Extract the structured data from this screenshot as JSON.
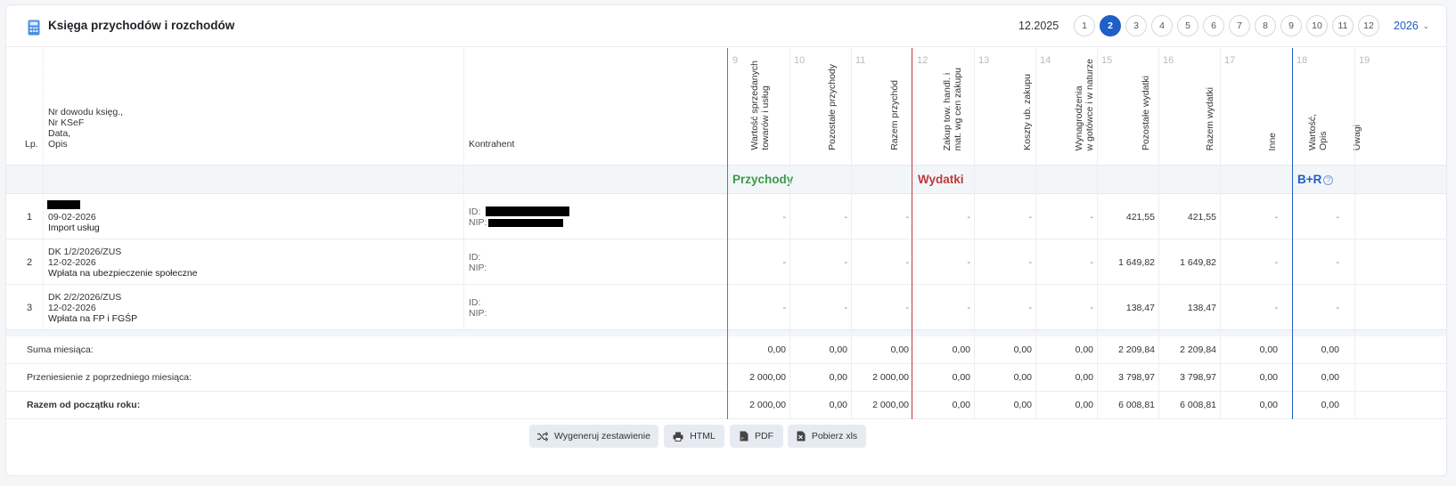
{
  "header": {
    "title": "Księga przychodów i rozchodów",
    "period": "12.2025",
    "pages": [
      "1",
      "2",
      "3",
      "4",
      "5",
      "6",
      "7",
      "8",
      "9",
      "10",
      "11",
      "12"
    ],
    "active_page": "2",
    "year": "2026"
  },
  "columns": {
    "lp": "Lp.",
    "desc": [
      "Nr dowodu księg.,",
      "Nr KSeF",
      "Data,",
      "Opis"
    ],
    "kontrahent": "Kontrahent",
    "numbered": [
      {
        "num": "9",
        "label": "Wartość sprzedanych\ntowarów i usług"
      },
      {
        "num": "10",
        "label": "Pozostałe przychody"
      },
      {
        "num": "11",
        "label": "Razem przychód"
      },
      {
        "num": "12",
        "label": "Zakup tow. handl. i\nmat. wg cen zakupu"
      },
      {
        "num": "13",
        "label": "Koszty ub. zakupu"
      },
      {
        "num": "14",
        "label": "Wynagrodzenia\nw gotówce i w naturze"
      },
      {
        "num": "15",
        "label": "Pozostałe wydatki"
      },
      {
        "num": "16",
        "label": "Razem wydatki"
      },
      {
        "num": "17",
        "label": "Inne"
      },
      {
        "num": "18",
        "label": "Wartość,\nOpis"
      },
      {
        "num": "19",
        "label": "Uwagi"
      }
    ]
  },
  "sections": {
    "income": "Przychody",
    "expenses": "Wydatki",
    "br": "B+R",
    "income_color": "#3d9a4a",
    "expenses_color": "#c0393b",
    "br_color": "#1f5fc6"
  },
  "rows": [
    {
      "lp": "1",
      "doc": "",
      "date": "09-02-2026",
      "desc": "Import usług",
      "id_label": "ID:",
      "nip_label": "NIP:",
      "values": [
        "-",
        "-",
        "-",
        "-",
        "-",
        "-",
        "421,55",
        "421,55",
        "-",
        "-"
      ]
    },
    {
      "lp": "2",
      "doc": "DK 1/2/2026/ZUS",
      "date": "12-02-2026",
      "desc": "Wpłata na ubezpieczenie społeczne",
      "id_label": "ID:",
      "nip_label": "NIP:",
      "values": [
        "-",
        "-",
        "-",
        "-",
        "-",
        "-",
        "1 649,82",
        "1 649,82",
        "-",
        "-"
      ]
    },
    {
      "lp": "3",
      "doc": "DK 2/2/2026/ZUS",
      "date": "12-02-2026",
      "desc": "Wpłata na FP i FGŚP",
      "id_label": "ID:",
      "nip_label": "NIP:",
      "values": [
        "-",
        "-",
        "-",
        "-",
        "-",
        "-",
        "138,47",
        "138,47",
        "-",
        "-"
      ]
    }
  ],
  "summaries": [
    {
      "label": "Suma miesiąca:",
      "values": [
        "0,00",
        "0,00",
        "0,00",
        "0,00",
        "0,00",
        "0,00",
        "2 209,84",
        "2 209,84",
        "0,00",
        "0,00"
      ]
    },
    {
      "label": "Przeniesienie z poprzedniego miesiąca:",
      "values": [
        "2 000,00",
        "0,00",
        "2 000,00",
        "0,00",
        "0,00",
        "0,00",
        "3 798,97",
        "3 798,97",
        "0,00",
        "0,00"
      ]
    },
    {
      "label": "Razem od początku roku:",
      "values": [
        "2 000,00",
        "0,00",
        "2 000,00",
        "0,00",
        "0,00",
        "0,00",
        "6 008,81",
        "6 008,81",
        "0,00",
        "0,00"
      ]
    }
  ],
  "buttons": {
    "generate": "Wygeneruj zestawienie",
    "html": "HTML",
    "pdf": "PDF",
    "xls": "Pobierz xls"
  }
}
